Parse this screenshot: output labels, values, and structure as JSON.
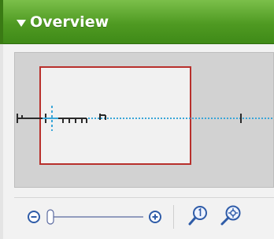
{
  "panel": {
    "title": "Overview",
    "toggle_icon": "triangle-down-icon",
    "colors": {
      "header_green": "#5aa22a",
      "viewport_border": "#b8302c",
      "timeline_blue": "#3aa6d8",
      "overview_bg": "#d2d2d2"
    }
  },
  "controls": {
    "zoom_out_icon": "minus-circle-icon",
    "zoom_in_icon": "plus-circle-icon",
    "slider_value": 0.0,
    "actual_size_icon": "magnifier-one-icon",
    "fit_icon": "magnifier-fit-icon"
  }
}
